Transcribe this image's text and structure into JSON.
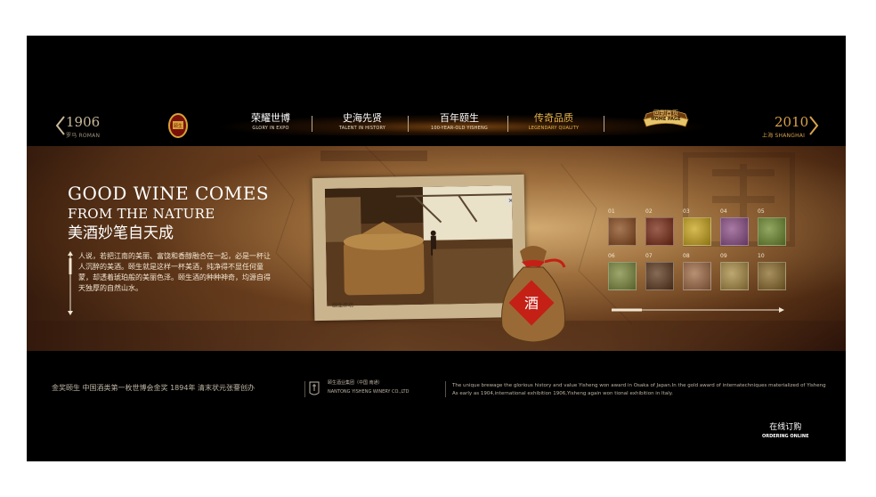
{
  "nav": {
    "prev_year": "1906",
    "prev_city": "罗马 ROMAN",
    "next_year": "2010",
    "next_city": "上海 SHANGHAI",
    "items": [
      {
        "cn": "荣耀世博",
        "en": "GLORY IN EXPO"
      },
      {
        "cn": "史海先贤",
        "en": "TALENT IN HISTORY"
      },
      {
        "cn": "百年颐生",
        "en": "100-YEAR-OLD YISHENG"
      },
      {
        "cn": "传奇品质",
        "en": "LEGENDARY QUALITY"
      }
    ],
    "home": {
      "cn": "回到首页",
      "en": "HOME PAGE"
    },
    "logo_text": "颐生",
    "accent": "#e8b64c"
  },
  "banner": {
    "headline_1": "GOOD WINE COMES",
    "headline_2": "FROM THE NATURE",
    "headline_cn": "美酒妙笔自天成",
    "body": "人说，若把江南的美丽、富饶和香醇融合在一起，必是一杯让人沉醉的美酒。颐生就是这样一杯美酒，纯净得不显任何童蒙，却透着琥珀般的美丽色泽。颐生酒的种种神奇，均源自得天独厚的自然山水。",
    "photo_caption": "颐生作坊",
    "sack_label": "酒",
    "close_glyph": "×",
    "thumbnails": [
      {
        "num": "01",
        "color": "#8a4a1c"
      },
      {
        "num": "02",
        "color": "#7a2a14"
      },
      {
        "num": "03",
        "color": "#c9a41a"
      },
      {
        "num": "04",
        "color": "#8c4e86"
      },
      {
        "num": "05",
        "color": "#6e8a2e"
      },
      {
        "num": "06",
        "color": "#7d8a3c"
      },
      {
        "num": "07",
        "color": "#5e3a1e"
      },
      {
        "num": "08",
        "color": "#a06a44"
      },
      {
        "num": "09",
        "color": "#a88a42"
      },
      {
        "num": "10",
        "color": "#8a6a2a"
      }
    ]
  },
  "footer": {
    "left_text": "金奖颐生   中国酒类第一枚世博会金奖   1894年 清末状元张謇创办",
    "company_cn": "颐生酒业集团（中国 南通）",
    "company_en": "NANTONG YISHENG WINERY CO.,LTD",
    "description": "The unique brewage the glorious history and value Yisheng won award in Osaka of Japan.In the gold award of internatechniques materialized of Yisheng As early as 1904,international exhibition 1906,Yisheng again won tional exhibition in Italy.",
    "order_cn": "在线订购",
    "order_en": "ORDERING ONLINE"
  }
}
